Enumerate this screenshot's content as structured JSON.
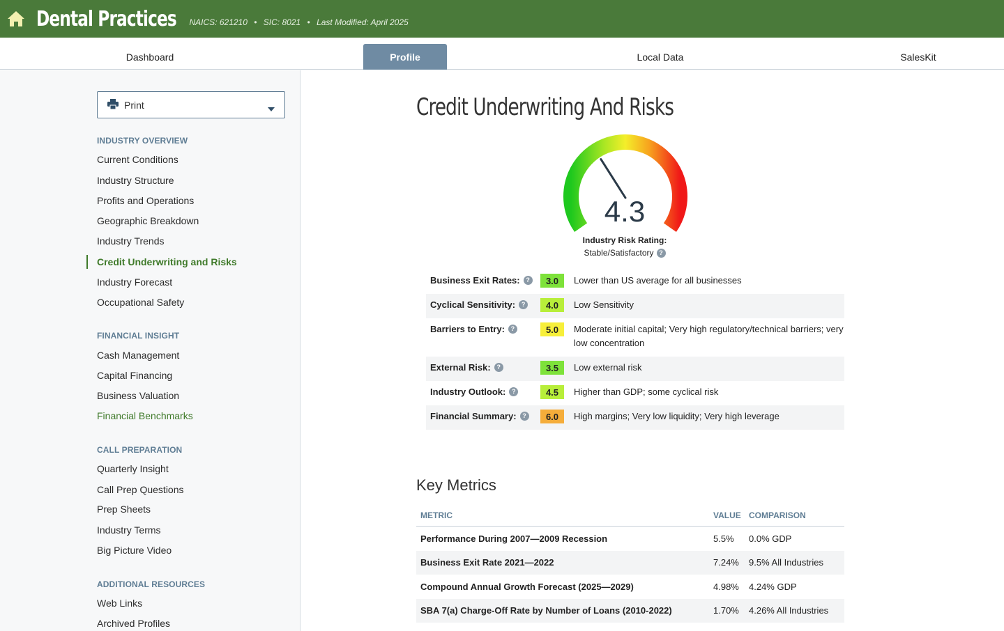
{
  "header": {
    "title": "Dental Practices",
    "naics": "NAICS: 621210",
    "sic": "SIC: 8021",
    "last_modified": "Last Modified: April 2025",
    "bullet": "•"
  },
  "tabs": [
    {
      "label": "Dashboard"
    },
    {
      "label": "Profile"
    },
    {
      "label": "Local Data"
    },
    {
      "label": "SalesKit"
    }
  ],
  "sidebar": {
    "print_label": "Print",
    "sections": [
      {
        "title": "INDUSTRY OVERVIEW",
        "items": [
          "Current Conditions",
          "Industry Structure",
          "Profits and Operations",
          "Geographic Breakdown",
          "Industry Trends",
          "Credit Underwriting and Risks",
          "Industry Forecast",
          "Occupational Safety"
        ]
      },
      {
        "title": "FINANCIAL INSIGHT",
        "items": [
          "Cash Management",
          "Capital Financing",
          "Business Valuation",
          "Financial Benchmarks"
        ]
      },
      {
        "title": "CALL PREPARATION",
        "items": [
          "Quarterly Insight",
          "Call Prep Questions",
          "Prep Sheets",
          "Industry Terms",
          "Big Picture Video"
        ]
      },
      {
        "title": "ADDITIONAL RESOURCES",
        "items": [
          "Web Links",
          "Archived Profiles"
        ]
      }
    ]
  },
  "main": {
    "title": "Credit Underwriting And Risks",
    "gauge": {
      "value": "4.3",
      "label": "Industry Risk Rating:",
      "status": "Stable/Satisfactory",
      "min": 1,
      "max": 10,
      "level": 4.3
    },
    "risks": [
      {
        "name": "Business Exit Rates:",
        "score": "3.0",
        "color": "#7ee23a",
        "desc": "Lower than US average for all businesses"
      },
      {
        "name": "Cyclical Sensitivity:",
        "score": "4.0",
        "color": "#b8ee3a",
        "desc": "Low Sensitivity"
      },
      {
        "name": "Barriers to Entry:",
        "score": "5.0",
        "color": "#f7ef3a",
        "desc": "Moderate initial capital; Very high regulatory/technical barriers; very low concentration"
      },
      {
        "name": "External Risk:",
        "score": "3.5",
        "color": "#7ee23a",
        "desc": "Low external risk"
      },
      {
        "name": "Industry Outlook:",
        "score": "4.5",
        "color": "#b8ee3a",
        "desc": "Higher than GDP; some cyclical risk"
      },
      {
        "name": "Financial Summary:",
        "score": "6.0",
        "color": "#f5ad3a",
        "desc": "High margins; Very low liquidity; Very high leverage"
      }
    ],
    "key_metrics": {
      "title": "Key Metrics",
      "headers": [
        "METRIC",
        "VALUE",
        "COMPARISON"
      ],
      "rows": [
        [
          "Performance During 2007—2009 Recession",
          "5.5%",
          "0.0% GDP"
        ],
        [
          "Business Exit Rate 2021—2022",
          "7.24%",
          "9.5% All Industries"
        ],
        [
          "Compound Annual Growth Forecast (2025—2029)",
          "4.98%",
          "4.24% GDP"
        ],
        [
          "SBA 7(a) Charge-Off Rate by Number of Loans (2010-2022)",
          "1.70%",
          "4.26% All Industries"
        ]
      ]
    }
  }
}
